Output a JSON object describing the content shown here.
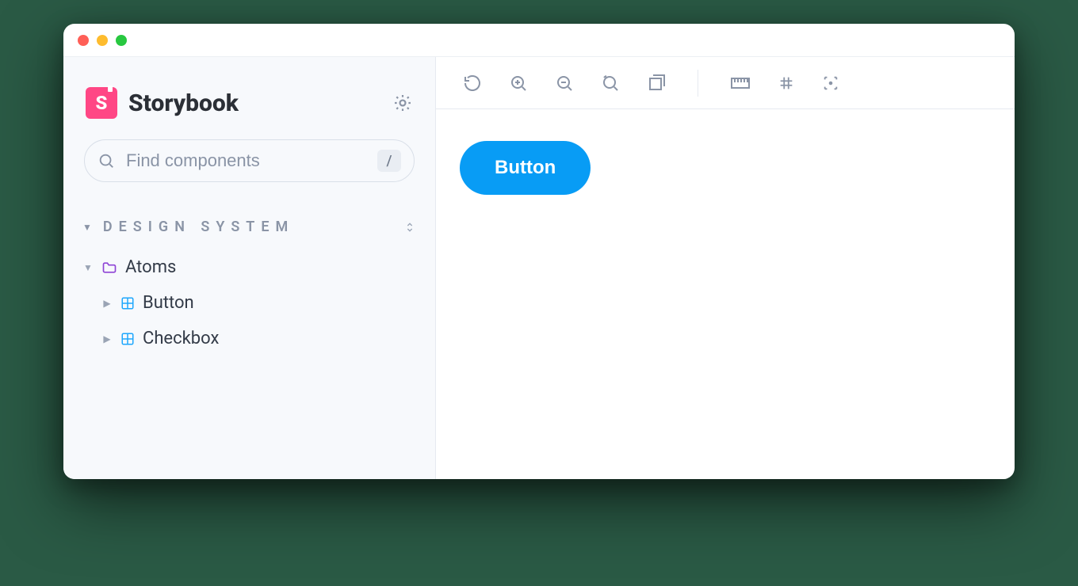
{
  "brand": {
    "name": "Storybook",
    "logo_letter": "S"
  },
  "search": {
    "placeholder": "Find components",
    "shortcut": "/"
  },
  "sidebar": {
    "section_title": "Design System",
    "folder": {
      "label": "Atoms"
    },
    "items": [
      {
        "label": "Button"
      },
      {
        "label": "Checkbox"
      }
    ]
  },
  "toolbar_icons": {
    "refresh": "refresh-icon",
    "zoom_in": "zoom-in-icon",
    "zoom_out": "zoom-out-icon",
    "zoom_reset": "zoom-reset-icon",
    "viewport": "viewport-icon",
    "ruler": "ruler-icon",
    "grid": "grid-icon",
    "outline": "outline-icon"
  },
  "preview": {
    "button_label": "Button"
  },
  "colors": {
    "accent": "#ff4785",
    "primary": "#089cf5",
    "muted": "#8a94a6"
  }
}
